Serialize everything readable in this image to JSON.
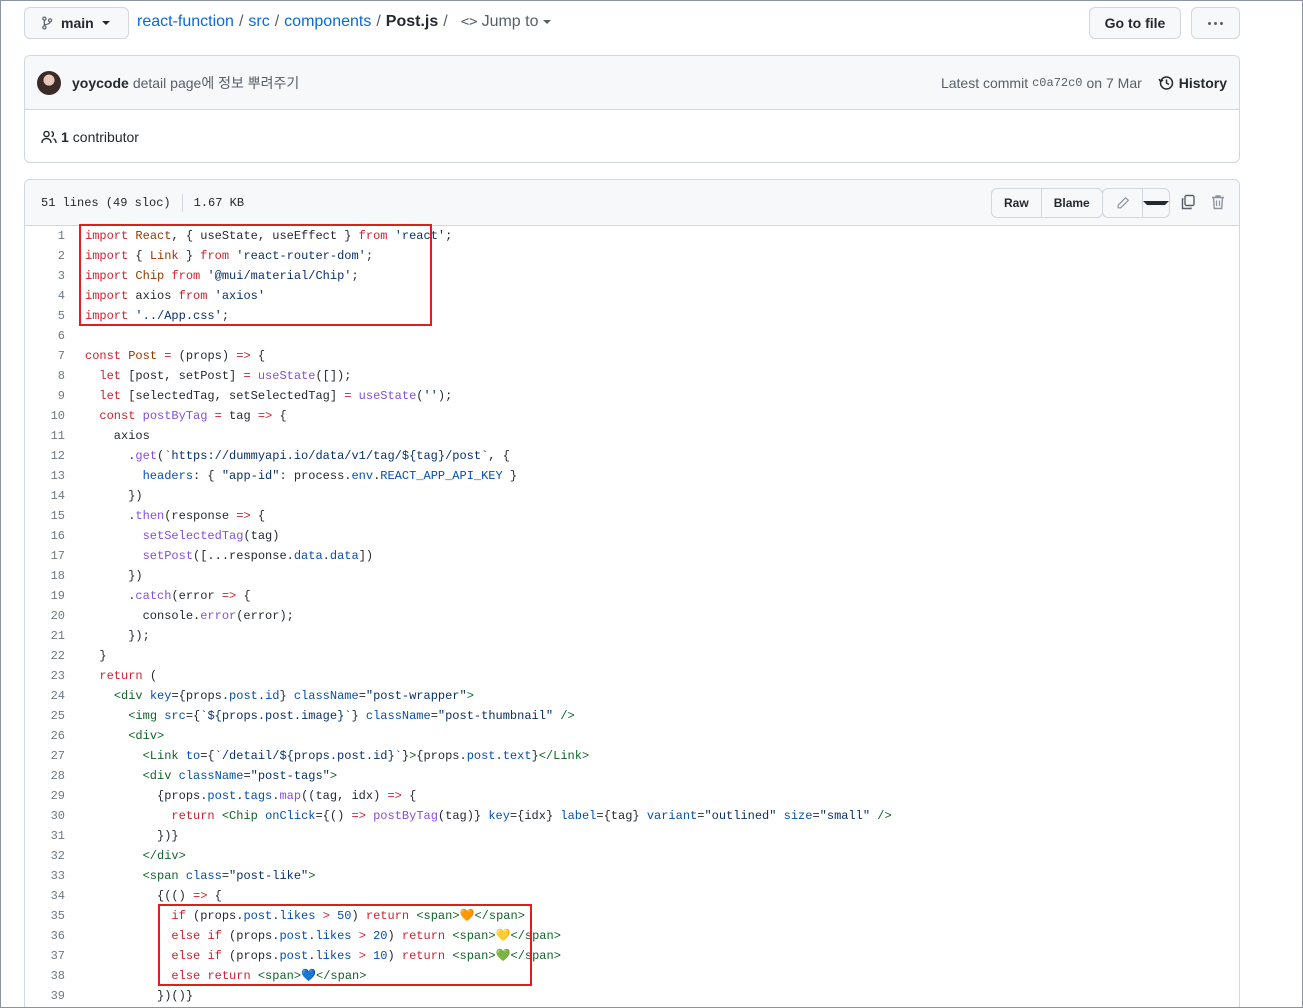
{
  "header": {
    "branch": "main",
    "breadcrumb": {
      "repo": "react-function",
      "dir1": "src",
      "dir2": "components",
      "file": "Post.js",
      "sep": "/"
    },
    "jump_to": "Jump to",
    "go_to_file": "Go to file",
    "more_icon": "kebab-horizontal-icon"
  },
  "commit": {
    "user": "yoycode",
    "message": "detail page에 정보 뿌려주기",
    "latest_label": "Latest commit",
    "sha": "c0a72c0",
    "date": "on 7 Mar",
    "history": "History",
    "contributors_count": "1",
    "contributors_label": "contributor"
  },
  "file": {
    "lines_info": "51 lines (49 sloc)",
    "size": "1.67 KB",
    "raw": "Raw",
    "blame": "Blame"
  },
  "colors": {
    "highlight_box": "#e11d1d",
    "link": "#0969da",
    "keyword": "#cf222e",
    "string": "#0a3069"
  },
  "code_lines": [
    {
      "n": "1",
      "html": "<span class='k'>import</span> <span class='e'>React</span>, { useState, useEffect } <span class='k'>from</span> <span class='s'>'react'</span>;"
    },
    {
      "n": "2",
      "html": "<span class='k'>import</span> { <span class='e'>Link</span> } <span class='k'>from</span> <span class='s'>'react-router-dom'</span>;"
    },
    {
      "n": "3",
      "html": "<span class='k'>import</span> <span class='e'>Chip</span> <span class='k'>from</span> <span class='s'>'@mui/material/Chip'</span>;"
    },
    {
      "n": "4",
      "html": "<span class='k'>import</span> axios <span class='k'>from</span> <span class='s'>'axios'</span>"
    },
    {
      "n": "5",
      "html": "<span class='k'>import</span> <span class='s'>'../App.css'</span>;"
    },
    {
      "n": "6",
      "html": ""
    },
    {
      "n": "7",
      "html": "<span class='k'>const</span> <span class='e'>Post</span> <span class='k'>=</span> (props) <span class='k'>=&gt;</span> {"
    },
    {
      "n": "8",
      "html": "  <span class='k'>let</span> [post, setPost] <span class='k'>=</span> <span class='f'>useState</span>([]);"
    },
    {
      "n": "9",
      "html": "  <span class='k'>let</span> [selectedTag, setSelectedTag] <span class='k'>=</span> <span class='f'>useState</span>(<span class='s'>''</span>);"
    },
    {
      "n": "10",
      "html": "  <span class='k'>const</span> <span class='f'>postByTag</span> <span class='k'>=</span> tag <span class='k'>=&gt;</span> {"
    },
    {
      "n": "11",
      "html": "    axios"
    },
    {
      "n": "12",
      "html": "      .<span class='f'>get</span>(<span class='s'>`https://dummyapi.io/data/v1/tag/${tag}/post`</span>, {"
    },
    {
      "n": "13",
      "html": "        <span class='c'>headers</span>: { <span class='s'>\"app-id\"</span>: process.<span class='c'>env</span>.<span class='c'>REACT_APP_API_KEY</span> }"
    },
    {
      "n": "14",
      "html": "      })"
    },
    {
      "n": "15",
      "html": "      .<span class='f'>then</span>(response <span class='k'>=&gt;</span> {"
    },
    {
      "n": "16",
      "html": "        <span class='f'>setSelectedTag</span>(tag)"
    },
    {
      "n": "17",
      "html": "        <span class='f'>setPost</span>([...response.<span class='c'>data</span>.<span class='c'>data</span>])"
    },
    {
      "n": "18",
      "html": "      })"
    },
    {
      "n": "19",
      "html": "      .<span class='f'>catch</span>(error <span class='k'>=&gt;</span> {"
    },
    {
      "n": "20",
      "html": "        console.<span class='f'>error</span>(error);"
    },
    {
      "n": "21",
      "html": "      });"
    },
    {
      "n": "22",
      "html": "  }"
    },
    {
      "n": "23",
      "html": "  <span class='k'>return</span> ("
    },
    {
      "n": "24",
      "html": "    <span class='t'>&lt;div</span> <span class='c'>key</span>={props.<span class='c'>post</span>.<span class='c'>id</span>} <span class='c'>className</span>=<span class='s'>\"post-wrapper\"</span><span class='t'>&gt;</span>"
    },
    {
      "n": "25",
      "html": "      <span class='t'>&lt;img</span> <span class='c'>src</span>={<span class='s'>`${props.post.image}`</span>} <span class='c'>className</span>=<span class='s'>\"post-thumbnail\"</span> <span class='t'>/&gt;</span>"
    },
    {
      "n": "26",
      "html": "      <span class='t'>&lt;div&gt;</span>"
    },
    {
      "n": "27",
      "html": "        <span class='t'>&lt;Link</span> <span class='c'>to</span>={<span class='s'>`/detail/${props.post.id}`</span>}<span class='t'>&gt;</span>{props.<span class='c'>post</span>.<span class='c'>text</span>}<span class='t'>&lt;/Link&gt;</span>"
    },
    {
      "n": "28",
      "html": "        <span class='t'>&lt;div</span> <span class='c'>className</span>=<span class='s'>\"post-tags\"</span><span class='t'>&gt;</span>"
    },
    {
      "n": "29",
      "html": "          {props.<span class='c'>post</span>.<span class='c'>tags</span>.<span class='f'>map</span>((tag, idx) <span class='k'>=&gt;</span> {"
    },
    {
      "n": "30",
      "html": "            <span class='k'>return</span> <span class='t'>&lt;Chip</span> <span class='c'>onClick</span>={() <span class='k'>=&gt;</span> <span class='f'>postByTag</span>(tag)} <span class='c'>key</span>={idx} <span class='c'>label</span>={tag} <span class='c'>variant</span>=<span class='s'>\"outlined\"</span> <span class='c'>size</span>=<span class='s'>\"small\"</span> <span class='t'>/&gt;</span>"
    },
    {
      "n": "31",
      "html": "          })}"
    },
    {
      "n": "32",
      "html": "        <span class='t'>&lt;/div&gt;</span>"
    },
    {
      "n": "33",
      "html": "        <span class='t'>&lt;span</span> <span class='c'>class</span>=<span class='s'>\"post-like\"</span><span class='t'>&gt;</span>"
    },
    {
      "n": "34",
      "html": "          {(() <span class='k'>=&gt;</span> {"
    },
    {
      "n": "35",
      "html": "            <span class='k'>if</span> (props.<span class='c'>post</span>.<span class='c'>likes</span> <span class='k'>&gt;</span> <span class='c'>50</span>) <span class='k'>return</span> <span class='t'>&lt;span&gt;</span>🧡<span class='t'>&lt;/span&gt;</span>"
    },
    {
      "n": "36",
      "html": "            <span class='k'>else</span> <span class='k'>if</span> (props.<span class='c'>post</span>.<span class='c'>likes</span> <span class='k'>&gt;</span> <span class='c'>20</span>) <span class='k'>return</span> <span class='t'>&lt;span&gt;</span>💛<span class='t'>&lt;/span&gt;</span>"
    },
    {
      "n": "37",
      "html": "            <span class='k'>else</span> <span class='k'>if</span> (props.<span class='c'>post</span>.<span class='c'>likes</span> <span class='k'>&gt;</span> <span class='c'>10</span>) <span class='k'>return</span> <span class='t'>&lt;span&gt;</span>💚<span class='t'>&lt;/span&gt;</span>"
    },
    {
      "n": "38",
      "html": "            <span class='k'>else</span> <span class='k'>return</span> <span class='t'>&lt;span&gt;</span>💙<span class='t'>&lt;/span&gt;</span>"
    },
    {
      "n": "39",
      "html": "          })()}"
    }
  ]
}
